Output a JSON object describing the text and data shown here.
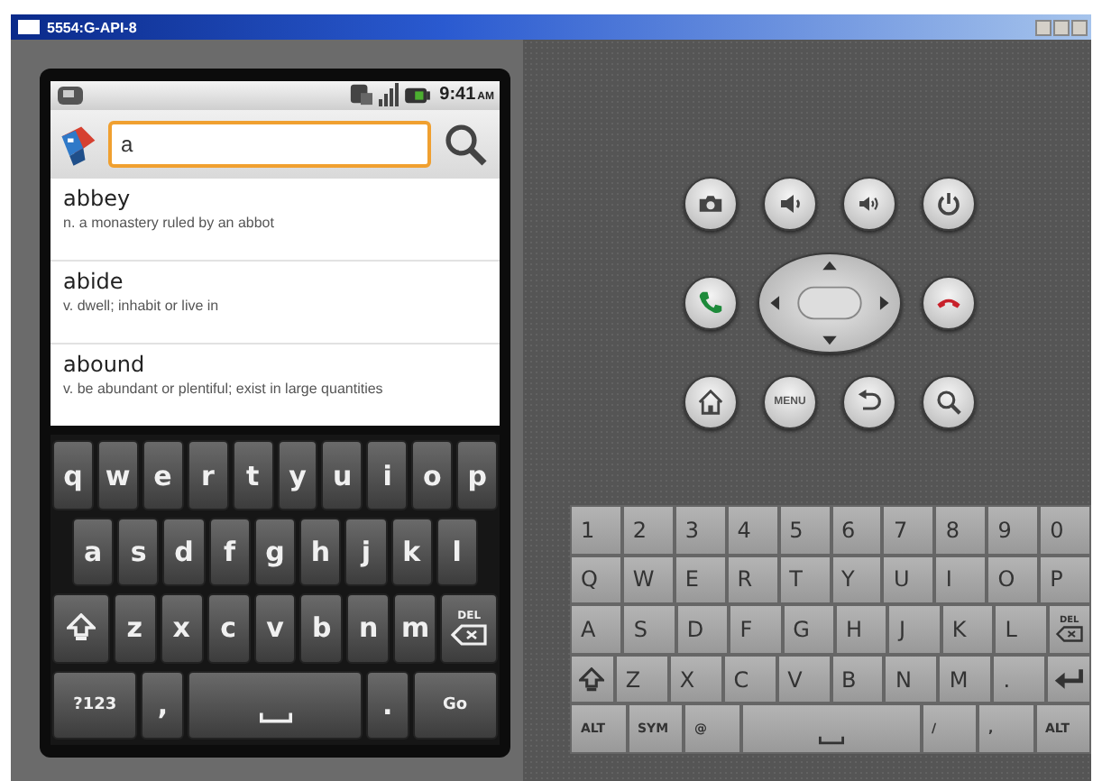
{
  "window": {
    "title": "5554:G-API-8"
  },
  "phone": {
    "status_bar": {
      "time": "9:41",
      "ampm": "AM"
    },
    "search": {
      "value": "a"
    },
    "results": [
      {
        "word": "abbey",
        "definition": "n. a monastery ruled by an abbot"
      },
      {
        "word": "abide",
        "definition": "v. dwell; inhabit or live in"
      },
      {
        "word": "abound",
        "definition": "v. be abundant or plentiful; exist in large quantities"
      }
    ],
    "soft_keyboard": {
      "rows": [
        [
          {
            "kind": "char",
            "label": "q"
          },
          {
            "kind": "char",
            "label": "w"
          },
          {
            "kind": "char",
            "label": "e"
          },
          {
            "kind": "char",
            "label": "r"
          },
          {
            "kind": "char",
            "label": "t"
          },
          {
            "kind": "char",
            "label": "y"
          },
          {
            "kind": "char",
            "label": "u"
          },
          {
            "kind": "char",
            "label": "i"
          },
          {
            "kind": "char",
            "label": "o"
          },
          {
            "kind": "char",
            "label": "p"
          }
        ],
        [
          {
            "kind": "char",
            "label": "a"
          },
          {
            "kind": "char",
            "label": "s"
          },
          {
            "kind": "char",
            "label": "d"
          },
          {
            "kind": "char",
            "label": "f"
          },
          {
            "kind": "char",
            "label": "g"
          },
          {
            "kind": "char",
            "label": "h"
          },
          {
            "kind": "char",
            "label": "j"
          },
          {
            "kind": "char",
            "label": "k"
          },
          {
            "kind": "char",
            "label": "l"
          }
        ],
        [
          {
            "kind": "shift"
          },
          {
            "kind": "char",
            "label": "z"
          },
          {
            "kind": "char",
            "label": "x"
          },
          {
            "kind": "char",
            "label": "c"
          },
          {
            "kind": "char",
            "label": "v"
          },
          {
            "kind": "char",
            "label": "b"
          },
          {
            "kind": "char",
            "label": "n"
          },
          {
            "kind": "char",
            "label": "m"
          },
          {
            "kind": "del",
            "label": "DEL"
          }
        ],
        [
          {
            "kind": "mode",
            "label": "?123"
          },
          {
            "kind": "char",
            "label": ","
          },
          {
            "kind": "space"
          },
          {
            "kind": "char",
            "label": "."
          },
          {
            "kind": "go",
            "label": "Go"
          }
        ]
      ]
    }
  },
  "controls": {
    "rows": [
      [
        {
          "kind": "camera"
        },
        {
          "kind": "volume-down"
        },
        {
          "kind": "volume-up"
        },
        {
          "kind": "power"
        }
      ],
      [
        {
          "kind": "call"
        },
        {
          "kind": "dpad"
        },
        {
          "kind": "end-call"
        }
      ],
      [
        {
          "kind": "home"
        },
        {
          "kind": "menu",
          "label": "MENU"
        },
        {
          "kind": "back"
        },
        {
          "kind": "search"
        }
      ]
    ]
  },
  "hardware_keyboard": {
    "rows": [
      [
        {
          "kind": "char",
          "label": "1"
        },
        {
          "kind": "char",
          "label": "2"
        },
        {
          "kind": "char",
          "label": "3"
        },
        {
          "kind": "char",
          "label": "4"
        },
        {
          "kind": "char",
          "label": "5"
        },
        {
          "kind": "char",
          "label": "6"
        },
        {
          "kind": "char",
          "label": "7"
        },
        {
          "kind": "char",
          "label": "8"
        },
        {
          "kind": "char",
          "label": "9"
        },
        {
          "kind": "char",
          "label": "0"
        }
      ],
      [
        {
          "kind": "char",
          "label": "Q"
        },
        {
          "kind": "char",
          "label": "W"
        },
        {
          "kind": "char",
          "label": "E"
        },
        {
          "kind": "char",
          "label": "R"
        },
        {
          "kind": "char",
          "label": "T"
        },
        {
          "kind": "char",
          "label": "Y"
        },
        {
          "kind": "char",
          "label": "U"
        },
        {
          "kind": "char",
          "label": "I"
        },
        {
          "kind": "char",
          "label": "O"
        },
        {
          "kind": "char",
          "label": "P"
        }
      ],
      [
        {
          "kind": "char",
          "label": "A"
        },
        {
          "kind": "char",
          "label": "S"
        },
        {
          "kind": "char",
          "label": "D"
        },
        {
          "kind": "char",
          "label": "F"
        },
        {
          "kind": "char",
          "label": "G"
        },
        {
          "kind": "char",
          "label": "H"
        },
        {
          "kind": "char",
          "label": "J"
        },
        {
          "kind": "char",
          "label": "K"
        },
        {
          "kind": "char",
          "label": "L"
        },
        {
          "kind": "del",
          "label": "DEL"
        }
      ],
      [
        {
          "kind": "shift"
        },
        {
          "kind": "char",
          "label": "Z"
        },
        {
          "kind": "char",
          "label": "X"
        },
        {
          "kind": "char",
          "label": "C"
        },
        {
          "kind": "char",
          "label": "V"
        },
        {
          "kind": "char",
          "label": "B"
        },
        {
          "kind": "char",
          "label": "N"
        },
        {
          "kind": "char",
          "label": "M"
        },
        {
          "kind": "char",
          "label": "."
        },
        {
          "kind": "enter"
        }
      ]
    ],
    "bottom_row": {
      "left_of_space": [
        {
          "kind": "char",
          "label": "ALT"
        },
        {
          "kind": "char",
          "label": "SYM"
        },
        {
          "kind": "char",
          "label": "@"
        }
      ],
      "right_of_space": [
        {
          "kind": "char",
          "label": "/"
        },
        {
          "kind": "char",
          "label": ","
        },
        {
          "kind": "char",
          "label": "ALT"
        }
      ]
    }
  }
}
